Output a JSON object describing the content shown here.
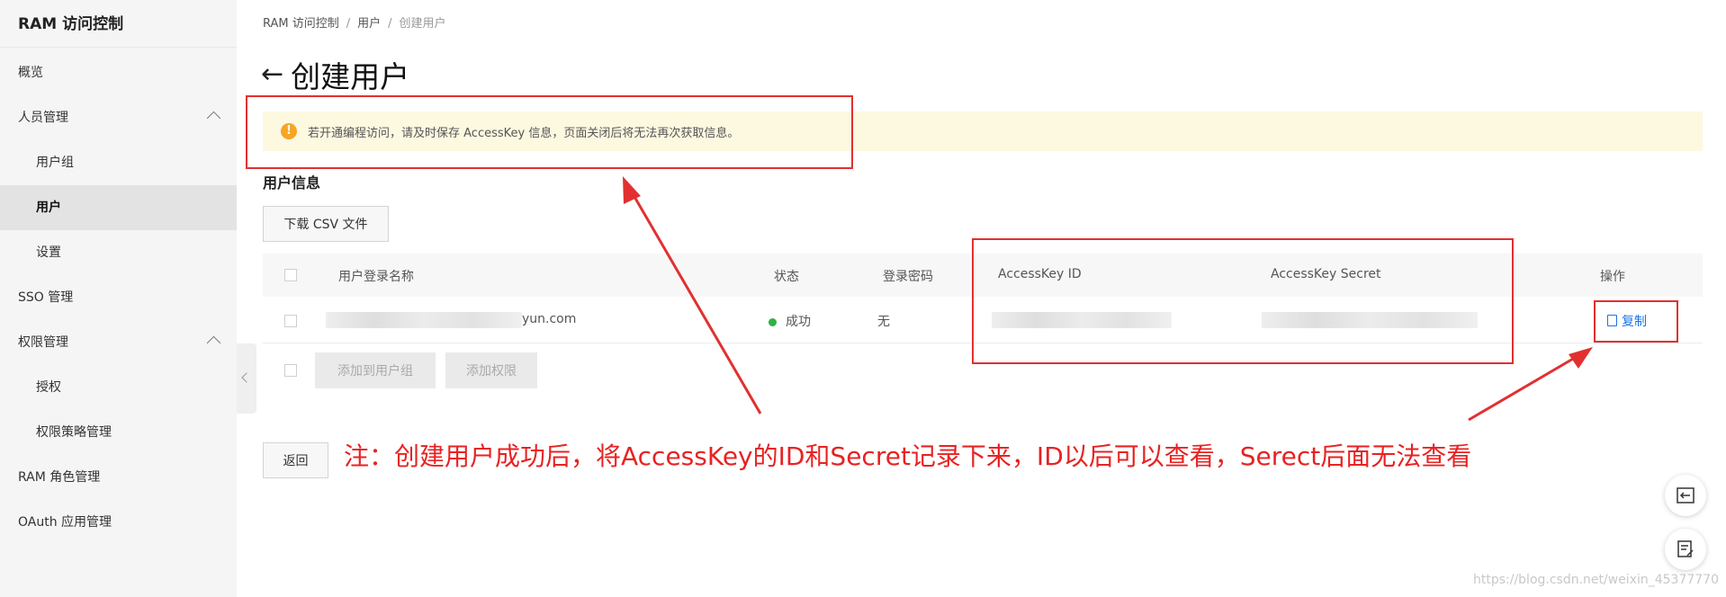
{
  "sidebar": {
    "title": "RAM 访问控制",
    "items": [
      {
        "label": "概览"
      },
      {
        "label": "人员管理"
      },
      {
        "label": "用户组"
      },
      {
        "label": "用户"
      },
      {
        "label": "设置"
      },
      {
        "label": "SSO 管理"
      },
      {
        "label": "权限管理"
      },
      {
        "label": "授权"
      },
      {
        "label": "权限策略管理"
      },
      {
        "label": "RAM 角色管理"
      },
      {
        "label": "OAuth 应用管理"
      }
    ]
  },
  "breadcrumb": [
    "RAM 访问控制",
    "用户",
    "创建用户"
  ],
  "page": {
    "title": "创建用户",
    "notice": "若开通编程访问，请及时保存 AccessKey 信息，页面关闭后将无法再次获取信息。",
    "section_title": "用户信息",
    "download_csv": "下载 CSV 文件"
  },
  "table": {
    "headers": [
      "用户登录名称",
      "状态",
      "登录密码",
      "AccessKey ID",
      "AccessKey Secret",
      "操作"
    ],
    "row": {
      "login_suffix": "yun.com",
      "status": "成功",
      "password": "无",
      "action": "复制"
    }
  },
  "actions": {
    "add_to_group": "添加到用户组",
    "add_permission": "添加权限",
    "back": "返回"
  },
  "annotation": "注：创建用户成功后，将AccessKey的ID和Secret记录下来，ID以后可以查看，Serect后面无法查看",
  "watermark": "https://blog.csdn.net/weixin_45377770",
  "colors": {
    "annotation_red": "#e23030",
    "link_blue": "#1a73e8",
    "success_green": "#2bb443",
    "warning_orange": "#f5a623"
  }
}
